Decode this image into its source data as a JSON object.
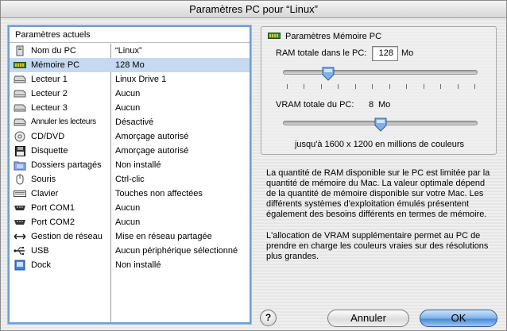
{
  "window": {
    "title": "Paramètres PC pour “Linux”"
  },
  "list": {
    "header": "Paramètres actuels",
    "rows": [
      {
        "icon": "computer-icon",
        "name": "Nom du PC",
        "value": "“Linux”"
      },
      {
        "icon": "memory-icon",
        "name": "Mémoire PC",
        "value": "128 Mo",
        "selected": true
      },
      {
        "icon": "drive-icon",
        "name": "Lecteur 1",
        "value": "Linux Drive 1"
      },
      {
        "icon": "drive-icon",
        "name": "Lecteur 2",
        "value": "Aucun"
      },
      {
        "icon": "drive-icon",
        "name": "Lecteur 3",
        "value": "Aucun"
      },
      {
        "icon": "drive-icon",
        "name": "Annuler les lecteurs",
        "value": "Désactivé"
      },
      {
        "icon": "cd-icon",
        "name": "CD/DVD",
        "value": "Amorçage autorisé"
      },
      {
        "icon": "floppy-icon",
        "name": "Disquette",
        "value": "Amorçage autorisé"
      },
      {
        "icon": "shared-folder-icon",
        "name": "Dossiers partagés",
        "value": "Non installé"
      },
      {
        "icon": "mouse-icon",
        "name": "Souris",
        "value": "Ctrl-clic"
      },
      {
        "icon": "keyboard-icon",
        "name": "Clavier",
        "value": "Touches non affectées"
      },
      {
        "icon": "serial-port-icon",
        "name": "Port COM1",
        "value": "Aucun"
      },
      {
        "icon": "serial-port-icon",
        "name": "Port COM2",
        "value": "Aucun"
      },
      {
        "icon": "network-icon",
        "name": "Gestion de réseau",
        "value": "Mise en réseau partagée"
      },
      {
        "icon": "usb-icon",
        "name": "USB",
        "value": "Aucun périphérique sélectionné"
      },
      {
        "icon": "dock-icon",
        "name": "Dock",
        "value": "Non installé"
      }
    ]
  },
  "memory": {
    "title": "Paramètres Mémoire PC",
    "ram_label": "RAM totale dans le PC:",
    "ram_value": "128",
    "ram_unit": "Mo",
    "ram_slider_fraction": 0.22,
    "vram_label": "VRAM totale du PC:",
    "vram_value": "8",
    "vram_unit": "Mo",
    "vram_slider_fraction": 0.5,
    "vram_caption": "jusqu'à 1600 x 1200 en millions de couleurs"
  },
  "description": {
    "p1": "La quantité de RAM disponible sur le PC est limitée par la quantité de mémoire du Mac. La valeur optimale dépend de la quantité de mémoire disponible sur votre Mac. Les différents systèmes d'exploitation émulés présentent également des besoins différents en termes de mémoire.",
    "p2": "L'allocation de VRAM supplémentaire permet au PC de prendre en charge les couleurs vraies sur des résolutions plus grandes."
  },
  "buttons": {
    "help": "?",
    "cancel": "Annuler",
    "ok": "OK"
  },
  "colors": {
    "selection": "#c5d9f1",
    "focus_ring": "#6d9fd6",
    "ok_button": "#4a89d8"
  }
}
